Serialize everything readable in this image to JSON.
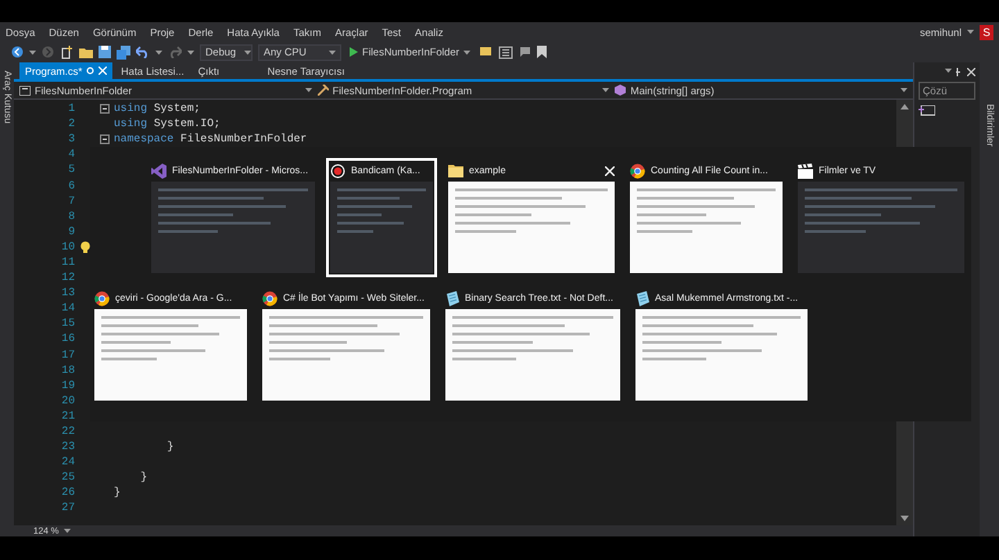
{
  "menu": {
    "items": [
      "Dosya",
      "Düzen",
      "Görünüm",
      "Proje",
      "Derle",
      "Hata Ayıkla",
      "Takım",
      "Araçlar",
      "Test",
      "Analiz"
    ],
    "user": "semihunl",
    "avatar": "S"
  },
  "toolbar": {
    "configuration": "Debug",
    "platform": "Any CPU",
    "start": "FilesNumberInFolder"
  },
  "left_strip": {
    "label": "Araç Kutusu"
  },
  "tabs": [
    {
      "label": "Program.cs*",
      "selected": true
    },
    {
      "label": "Hata Listesi...",
      "selected": false
    },
    {
      "label": "Çıktı",
      "selected": false
    },
    {
      "label": "Nesne Tarayıcısı",
      "selected": false
    }
  ],
  "navigation": {
    "project": "FilesNumberInFolder",
    "type": "FilesNumberInFolder.Program",
    "member": "Main(string[] args)"
  },
  "code_lines": [
    {
      "n": "1",
      "fold": true,
      "lightbulb": false,
      "parts": [
        {
          "kind": "keyword",
          "text": "using"
        },
        {
          "kind": "plain",
          "text": " System;"
        }
      ]
    },
    {
      "n": "2",
      "fold": false,
      "lightbulb": false,
      "parts": [
        {
          "kind": "keyword",
          "text": "using"
        },
        {
          "kind": "plain",
          "text": " System.IO;"
        }
      ]
    },
    {
      "n": "3",
      "fold": true,
      "lightbulb": false,
      "parts": [
        {
          "kind": "keyword",
          "text": "namespace"
        },
        {
          "kind": "plain",
          "text": " FilesNumberInFolder"
        }
      ]
    },
    {
      "n": "4"
    },
    {
      "n": "5"
    },
    {
      "n": "6"
    },
    {
      "n": "7"
    },
    {
      "n": "8"
    },
    {
      "n": "9"
    },
    {
      "n": "10",
      "lightbulb": true
    },
    {
      "n": "11"
    },
    {
      "n": "12"
    },
    {
      "n": "13"
    },
    {
      "n": "14"
    },
    {
      "n": "15"
    },
    {
      "n": "16"
    },
    {
      "n": "17"
    },
    {
      "n": "18"
    },
    {
      "n": "19"
    },
    {
      "n": "20"
    },
    {
      "n": "21"
    },
    {
      "n": "22",
      "fold": false,
      "lightbulb": false
    },
    {
      "n": "23",
      "fold": false,
      "lightbulb": false,
      "parts": [
        {
          "kind": "plain",
          "text": "        }"
        }
      ]
    },
    {
      "n": "24",
      "fold": false,
      "lightbulb": false
    },
    {
      "n": "25",
      "fold": false,
      "lightbulb": false,
      "parts": [
        {
          "kind": "plain",
          "text": "    }"
        }
      ]
    },
    {
      "n": "26",
      "fold": false,
      "lightbulb": false,
      "parts": [
        {
          "kind": "plain",
          "text": "}"
        }
      ]
    },
    {
      "n": "27",
      "fold": false,
      "lightbulb": false
    }
  ],
  "status": {
    "zoom": "124 %"
  },
  "right_panel": {
    "header": "Çözü",
    "vertical_label": "Bildirimler"
  },
  "task_switcher": {
    "rows": [
      [
        {
          "title": "FilesNumberInFolder - Micros...",
          "kind": "visual-studio",
          "dark_preview": true,
          "selected": false,
          "close": false
        },
        {
          "title": "Bandicam (Ka...",
          "kind": "bandicam",
          "dark_preview": true,
          "selected": true,
          "close": false
        },
        {
          "title": "example",
          "kind": "folder",
          "dark_preview": false,
          "selected": false,
          "close": true
        },
        {
          "title": "Counting All File Count in...",
          "kind": "chrome",
          "dark_preview": false,
          "selected": false,
          "close": false
        },
        {
          "title": "Filmler ve TV",
          "kind": "film",
          "dark_preview": true,
          "selected": false,
          "close": false
        }
      ],
      [
        {
          "title": "çeviri - Google'da Ara - G...",
          "kind": "chrome",
          "dark_preview": false,
          "selected": false,
          "close": false
        },
        {
          "title": "C# İle Bot Yapımı - Web Siteler...",
          "kind": "chrome",
          "dark_preview": false,
          "selected": false,
          "close": false
        },
        {
          "title": "Binary Search Tree.txt - Not Deft...",
          "kind": "notepad",
          "dark_preview": false,
          "selected": false,
          "close": false
        },
        {
          "title": "Asal Mukemmel Armstrong.txt -...",
          "kind": "notepad",
          "dark_preview": false,
          "selected": false,
          "close": false
        }
      ]
    ]
  }
}
